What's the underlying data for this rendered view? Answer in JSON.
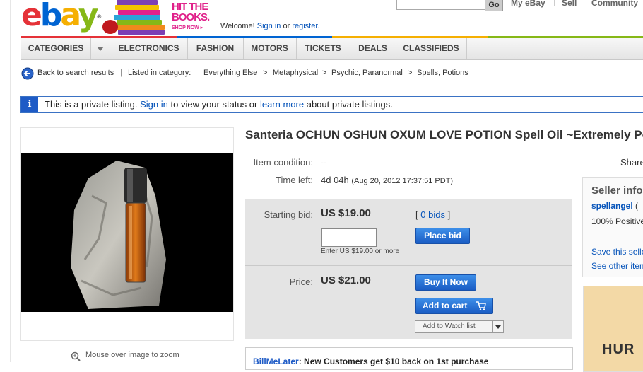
{
  "header": {
    "logo": {
      "e": "e",
      "b": "b",
      "a": "a",
      "y": "y",
      "reg": "®"
    },
    "banner": {
      "line1": "HIT THE",
      "line2": "BOOKS.",
      "cta": "SHOP NOW ▸"
    },
    "welcome_prefix": "Welcome!",
    "sign_in": "Sign in",
    "or": "or",
    "register": "register.",
    "go_button": "Go",
    "top_links": [
      "My eBay",
      "Sell",
      "Community"
    ]
  },
  "nav": {
    "items": [
      "CATEGORIES",
      "ELECTRONICS",
      "FASHION",
      "MOTORS",
      "TICKETS",
      "DEALS",
      "CLASSIFIEDS"
    ]
  },
  "breadcrumb": {
    "back": "Back to search results",
    "separator": "|",
    "listed_in": "Listed in category:",
    "path": [
      "Everything Else",
      "Metaphysical",
      "Psychic, Paranormal",
      "Spells, Potions"
    ],
    "arrow": ">"
  },
  "notice": {
    "icon": "i",
    "part1": "This is a private listing.",
    "sign_in": "Sign in",
    "part2": "to view your status or",
    "learn_more": "learn more",
    "part3": "about private listings."
  },
  "listing": {
    "title": "Santeria OCHUN OSHUN OXUM LOVE POTION Spell Oil ~Extremely Po",
    "condition_label": "Item condition:",
    "condition_value": "--",
    "time_left_label": "Time left:",
    "time_left_value": "4d 04h",
    "end_time": "(Aug 20, 2012  17:37:51 PDT)",
    "share": "Share",
    "starting_bid_label": "Starting bid:",
    "starting_bid_value": "US $19.00",
    "bids_open": "[",
    "bids": "0 bids",
    "bids_close": "]",
    "place_bid": "Place bid",
    "bid_hint": "Enter US $19.00 or more",
    "price_label": "Price:",
    "price_value": "US $21.00",
    "buy_it_now": "Buy It Now",
    "add_to_cart": "Add to cart",
    "watch_list": "Add to Watch list",
    "zoom_hint": "Mouse over image to zoom",
    "paypal_brand": "BillMeLater",
    "paypal_text": "New Customers get $10 back on 1st purchase"
  },
  "seller": {
    "title": "Seller info",
    "name": "spellangel",
    "name_suffix": "(",
    "positive": "100% Positive",
    "save": "Save this seller",
    "see_other": "See other items"
  },
  "ad": {
    "text": "HUR"
  },
  "colors": {
    "link": "#0654ba",
    "button": "#1a5cc4",
    "panel": "#e4e4e4",
    "info": "#1e5bc6"
  }
}
